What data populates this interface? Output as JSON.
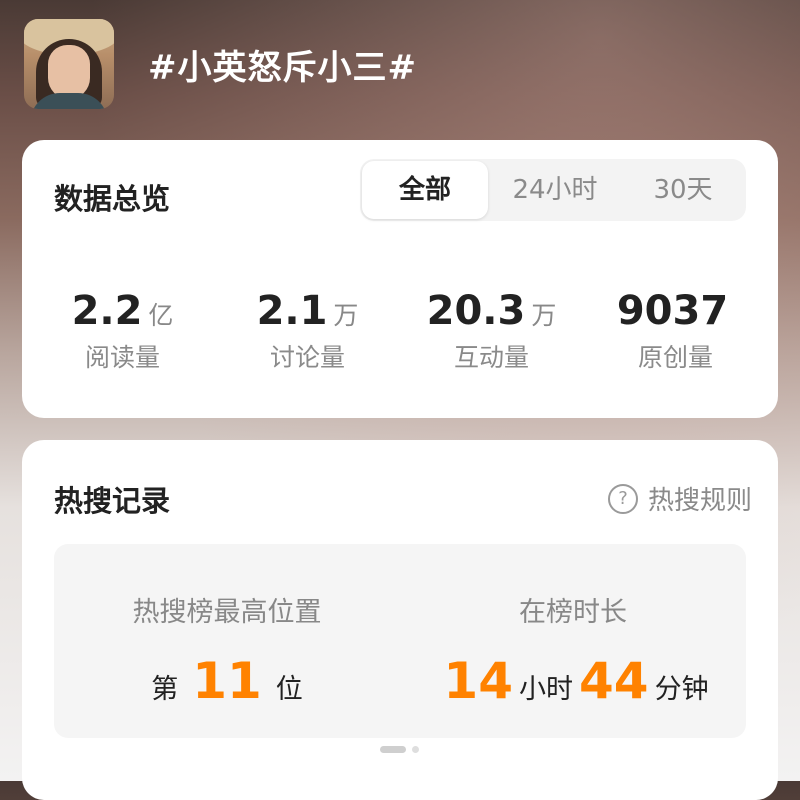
{
  "header": {
    "title": "#小英怒斥小三#"
  },
  "overview": {
    "title": "数据总览",
    "tabs": [
      "全部",
      "24小时",
      "30天"
    ],
    "stats": [
      {
        "value": "2.2",
        "unit": "亿",
        "label": "阅读量"
      },
      {
        "value": "2.1",
        "unit": "万",
        "label": "讨论量"
      },
      {
        "value": "20.3",
        "unit": "万",
        "label": "互动量"
      },
      {
        "value": "9037",
        "unit": "",
        "label": "原创量"
      }
    ]
  },
  "hot_search": {
    "title": "热搜记录",
    "rules_label": "热搜规则",
    "rules_icon": "?",
    "highest": {
      "label": "热搜榜最高位置",
      "prefix": "第",
      "value": "11",
      "suffix": "位"
    },
    "duration": {
      "label": "在榜时长",
      "hours": "14",
      "hours_unit": "小时",
      "minutes": "44",
      "minutes_unit": "分钟"
    },
    "page_index": 1,
    "page_count": 2
  },
  "colors": {
    "accent": "#ff8200",
    "card_bg": "#ffffff",
    "text_primary": "#222222",
    "text_secondary": "#888888"
  }
}
